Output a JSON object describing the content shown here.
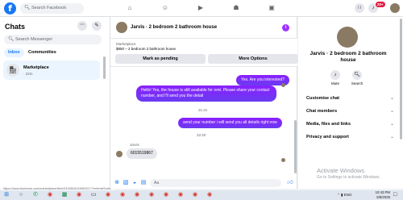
{
  "topbar": {
    "logo": "f",
    "search_placeholder": "Search Facebook",
    "notification_count": "20+"
  },
  "chats": {
    "title": "Chats",
    "search_placeholder": "Search Messenger",
    "tabs": [
      "Inbox",
      "Communities"
    ],
    "active_tab": "Inbox",
    "conversations": [
      {
        "name": "Marketplace",
        "time": "· 22m"
      }
    ]
  },
  "conversation": {
    "title": "Jarvis · 2 bedroom 2 bathroom house",
    "marketplace_label": "Marketplace",
    "listing": "$850 – 2 bedroom 2 bathroom house",
    "mark_pending_label": "Mark as pending",
    "more_options_label": "More Options",
    "messages": [
      {
        "text": "Yes. Are you interested?"
      },
      {
        "text": "Hello! Yes, the house  is still available for rent. Please share your contact number, and I'll send you the detail"
      },
      {
        "timestamp": "21:41"
      },
      {
        "text": "send your number i will send you all details right now"
      },
      {
        "timestamp": "22:20"
      },
      {
        "sender": "Jarvis",
        "text": "6015519867"
      }
    ],
    "composer_placeholder": "Aa"
  },
  "info_panel": {
    "name": "Jarvis · 2 bedroom 2 bathroom house",
    "actions": [
      "Mute",
      "Search"
    ],
    "rows": [
      "Customise chat",
      "Chat members",
      "Media, files and links",
      "Privacy and support"
    ],
    "watermark_title": "Activate Windows",
    "watermark_sub": "Go to Settings to activate Windows."
  },
  "statusbar": {
    "url": "https://www.facebook.com/marketplace/item/2415816124980217/?referralSurfa..."
  },
  "taskbar": {
    "time": "10:43 PM",
    "date": "5/8/2025",
    "lang": "ENG"
  },
  "colors": {
    "brand": "#1877f2",
    "outgoing_bubble": "#7b2ff7",
    "incoming_bubble": "#e4e6eb"
  }
}
